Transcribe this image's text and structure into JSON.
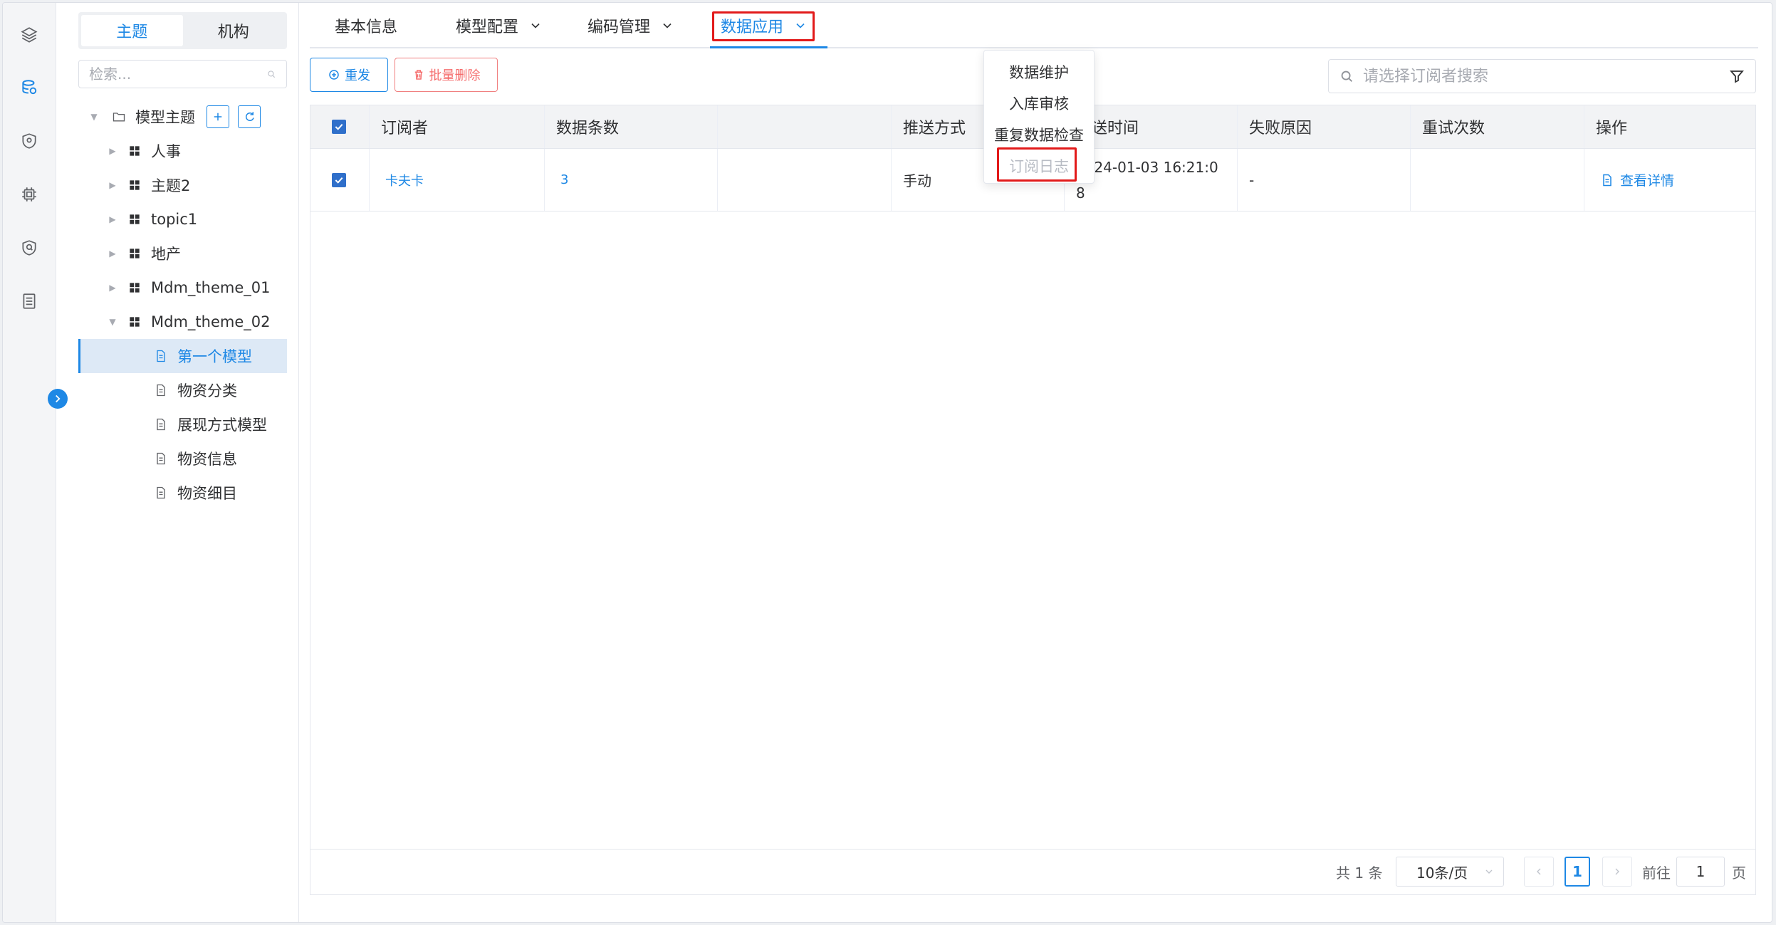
{
  "rail": {
    "icons": [
      "layers-icon",
      "database-icon",
      "shield-icon",
      "chip-icon",
      "security-icon",
      "list-doc-icon"
    ]
  },
  "tree": {
    "tabs": [
      "主题",
      "机构"
    ],
    "active_tab": 0,
    "search_placeholder": "检索...",
    "root": {
      "label": "模型主题"
    },
    "nodes": [
      {
        "label": "人事"
      },
      {
        "label": "主题2"
      },
      {
        "label": "topic1"
      },
      {
        "label": "地产"
      },
      {
        "label": "Mdm_theme_01"
      },
      {
        "label": "Mdm_theme_02"
      }
    ],
    "children": [
      {
        "label": "第一个模型"
      },
      {
        "label": "物资分类"
      },
      {
        "label": "展现方式模型"
      },
      {
        "label": "物资信息"
      },
      {
        "label": "物资细目"
      }
    ]
  },
  "tabs": [
    {
      "label": "基本信息"
    },
    {
      "label": "模型配置"
    },
    {
      "label": "编码管理"
    },
    {
      "label": "数据应用"
    }
  ],
  "dropdown": {
    "items": [
      {
        "label": "数据维护"
      },
      {
        "label": "入库审核"
      },
      {
        "label": "重复数据检查"
      },
      {
        "label": "订阅日志"
      }
    ]
  },
  "toolbar": {
    "resend_label": "重发",
    "batch_delete_label": "批量删除",
    "search_placeholder": "请选择订阅者搜索"
  },
  "table": {
    "headers": [
      "订阅者",
      "数据条数",
      "",
      "推送方式",
      "推送时间",
      "失败原因",
      "重试次数",
      "操作"
    ],
    "rows": [
      {
        "subscriber": "卡夫卡",
        "count": "3",
        "col3": "",
        "push_method": "手动",
        "push_time_1": "2024-01-03 16:21:0",
        "push_time_2": "8",
        "fail_reason": "-",
        "retry": "",
        "action": "查看详情"
      }
    ]
  },
  "pager": {
    "total": "共 1 条",
    "page_size": "10条/页",
    "current": "1",
    "goto_label": "前往",
    "goto_value": "1",
    "page_suffix": "页"
  },
  "colors": {
    "primary": "#1e88e5",
    "highlight": "#e21a1a",
    "danger": "#f56c6c"
  }
}
